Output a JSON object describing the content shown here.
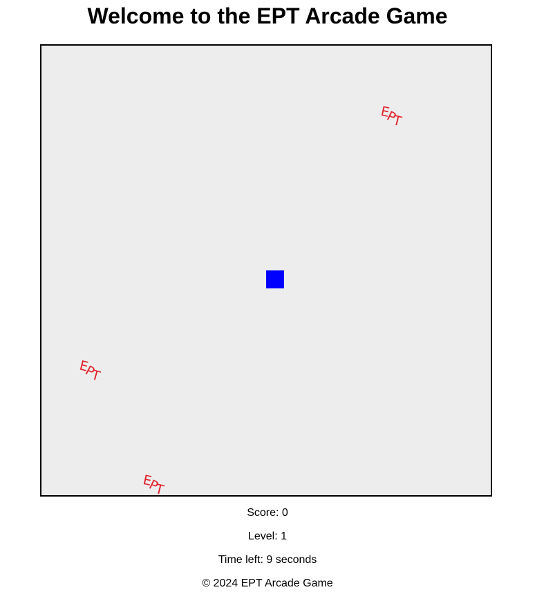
{
  "header": {
    "title": "Welcome to the EPT Arcade Game"
  },
  "game": {
    "board_color": "#ededed",
    "player_color": "#0000ff",
    "enemy_color": "#e0202a",
    "enemies": [
      {
        "label": "EPT"
      },
      {
        "label": "EPT"
      },
      {
        "label": "EPT"
      }
    ]
  },
  "status": {
    "score_text": "Score: 0",
    "level_text": "Level: 1",
    "time_text": "Time left: 9 seconds"
  },
  "footer": {
    "copyright": "© 2024 EPT Arcade Game"
  }
}
